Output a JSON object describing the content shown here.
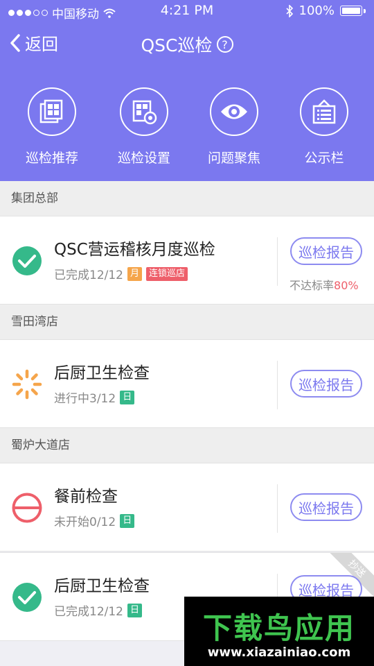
{
  "status_bar": {
    "carrier": "中国移动",
    "time": "4:21 PM",
    "battery": "100%"
  },
  "nav": {
    "back_label": "返回",
    "title": "QSC巡检",
    "help_glyph": "?"
  },
  "quick_actions": [
    {
      "label": "巡检推荐",
      "icon": "copy-grid-icon"
    },
    {
      "label": "巡检设置",
      "icon": "grid-gear-icon"
    },
    {
      "label": "问题聚焦",
      "icon": "eye-icon"
    },
    {
      "label": "公示栏",
      "icon": "notice-board-icon"
    }
  ],
  "sections": [
    {
      "name": "集团总部"
    },
    {
      "name": "雪田湾店"
    },
    {
      "name": "蜀炉大道店"
    }
  ],
  "tasks": [
    {
      "title": "QSC营运稽核月度巡检",
      "status": "已完成12/12",
      "status_icon": "check-circle-icon",
      "tags": [
        "月",
        "连锁巡店"
      ],
      "report_label": "巡检报告",
      "rate_label": "不达标率",
      "rate_value": "80%"
    },
    {
      "title": "后厨卫生检查",
      "status": "进行中3/12",
      "status_icon": "loading-spinner-icon",
      "tags": [
        "日"
      ],
      "report_label": "巡检报告"
    },
    {
      "title": "餐前检查",
      "status": "未开始0/12",
      "status_icon": "not-started-icon",
      "tags": [
        "日"
      ],
      "report_label": "巡检报告"
    },
    {
      "title": "后厨卫生检查",
      "status": "已完成12/12",
      "status_icon": "check-circle-icon",
      "tags": [
        "日"
      ],
      "report_label": "巡检报告",
      "corner_label": "抄送"
    }
  ],
  "watermark": {
    "brand": "下载鸟应用",
    "url": "www.xiazainiao.com"
  },
  "colors": {
    "primary": "#7b78ef",
    "success": "#35b98a",
    "warning": "#f5a54b",
    "danger": "#ee5f6a"
  }
}
